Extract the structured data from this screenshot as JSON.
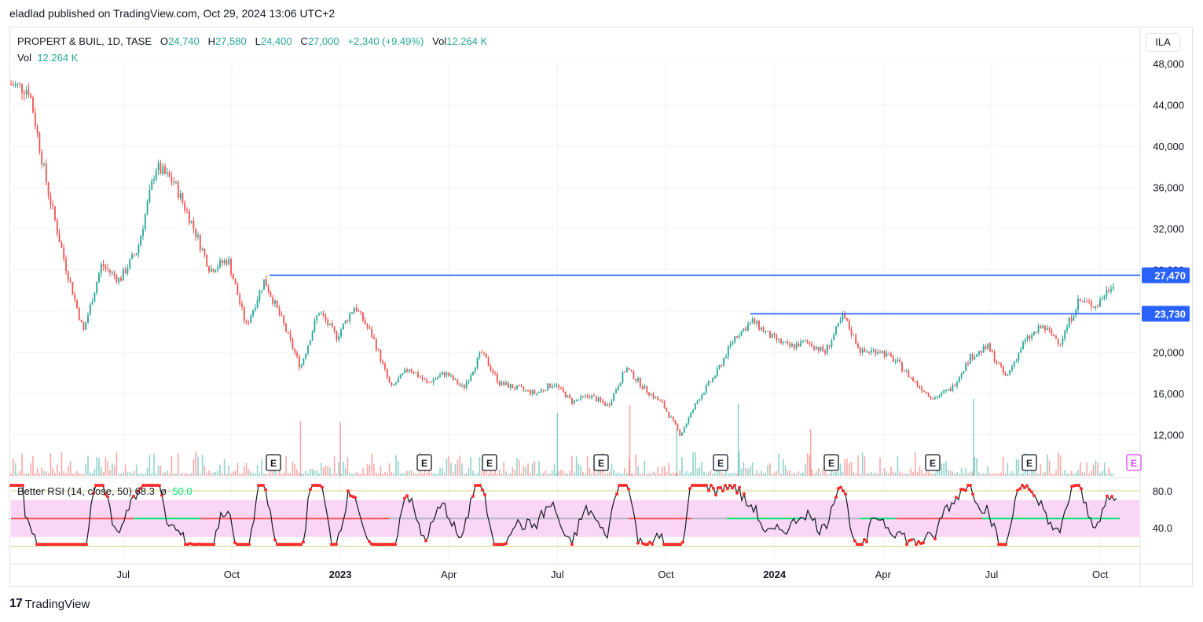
{
  "header": {
    "published_line": "eladlad published on TradingView.com, Oct 29, 2024 13:06 UTC+2"
  },
  "legend": {
    "symbol": "PROPERT & BUIL, 1D, TASE",
    "open_label": "O",
    "open": "24,740",
    "high_label": "H",
    "high": "27,580",
    "low_label": "L",
    "low": "24,400",
    "close_label": "C",
    "close": "27,000",
    "change": "+2,340 (+9.49%)",
    "vol_label": "Vol",
    "vol": "12.264 K",
    "vol_line_label": "Vol",
    "vol_line_value": "12.264 K"
  },
  "rsi_legend": {
    "title": "Better RSI (14, close, 50)",
    "value": "68.3",
    "symbol": "ø",
    "mid": "50.0"
  },
  "currency_button": "ILA",
  "footer": {
    "brand": "TradingView",
    "logo_glyph": "17"
  },
  "colors": {
    "up": "#26a69a",
    "down": "#ef5350",
    "hline": "#2962ff",
    "rsi_band": "#f9d6f5",
    "rsi_above": "#ff2a2a",
    "rsi_mid_green": "#00e676",
    "rsi_mid_red": "#ff5252",
    "rsi_mid_gray": "#b2b5be",
    "earnings_alt": "#e040fb"
  },
  "chart_data": {
    "type": "candlestick",
    "title": "PROPERT & BUIL, 1D, TASE",
    "x_ticks": [
      "Jul",
      "Oct",
      "2023",
      "Apr",
      "Jul",
      "Oct",
      "2024",
      "Apr",
      "Jul",
      "Oct"
    ],
    "y_ticks": [
      "48,000",
      "44,000",
      "40,000",
      "36,000",
      "32,000",
      "28,000",
      "24,000",
      "20,000",
      "16,000",
      "12,000"
    ],
    "y_range": [
      8500,
      50500
    ],
    "close_path": [
      {
        "t": "Apr 2022",
        "c": 46000
      },
      {
        "t": "May 2022",
        "c": 45500
      },
      {
        "t": "Jun 2022",
        "c": 36000
      },
      {
        "t": "Jun 2022",
        "c": 28500
      },
      {
        "t": "Jul 2022",
        "c": 22000
      },
      {
        "t": "Jul 2022",
        "c": 28500
      },
      {
        "t": "Jul 2022",
        "c": 27000
      },
      {
        "t": "Aug 2022",
        "c": 30000
      },
      {
        "t": "Aug 2022",
        "c": 38000
      },
      {
        "t": "Sep 2022",
        "c": 36500
      },
      {
        "t": "Sep 2022",
        "c": 32500
      },
      {
        "t": "Oct 2022",
        "c": 28000
      },
      {
        "t": "Oct 2022",
        "c": 29000
      },
      {
        "t": "Nov 2022",
        "c": 22500
      },
      {
        "t": "Nov 2022",
        "c": 27000
      },
      {
        "t": "Dec 2022",
        "c": 23000
      },
      {
        "t": "Dec 2022",
        "c": 18500
      },
      {
        "t": "Jan 2023",
        "c": 24000
      },
      {
        "t": "Jan 2023",
        "c": 21500
      },
      {
        "t": "Feb 2023",
        "c": 24500
      },
      {
        "t": "Feb 2023",
        "c": 21500
      },
      {
        "t": "Mar 2023",
        "c": 16500
      },
      {
        "t": "Mar 2023",
        "c": 18500
      },
      {
        "t": "Apr 2023",
        "c": 17000
      },
      {
        "t": "Apr 2023",
        "c": 18000
      },
      {
        "t": "May 2023",
        "c": 16500
      },
      {
        "t": "May 2023",
        "c": 20000
      },
      {
        "t": "Jun 2023",
        "c": 17000
      },
      {
        "t": "Jun 2023",
        "c": 16500
      },
      {
        "t": "Jul 2023",
        "c": 16000
      },
      {
        "t": "Jul 2023",
        "c": 17000
      },
      {
        "t": "Aug 2023",
        "c": 15200
      },
      {
        "t": "Aug 2023",
        "c": 15800
      },
      {
        "t": "Sep 2023",
        "c": 14800
      },
      {
        "t": "Sep 2023",
        "c": 18500
      },
      {
        "t": "Oct 2023",
        "c": 16500
      },
      {
        "t": "Oct 2023",
        "c": 15000
      },
      {
        "t": "Nov 2023",
        "c": 12000
      },
      {
        "t": "Nov 2023",
        "c": 15500
      },
      {
        "t": "Dec 2023",
        "c": 18000
      },
      {
        "t": "Dec 2023",
        "c": 21500
      },
      {
        "t": "Jan 2024",
        "c": 23000
      },
      {
        "t": "Jan 2024",
        "c": 21500
      },
      {
        "t": "Feb 2024",
        "c": 20500
      },
      {
        "t": "Feb 2024",
        "c": 21000
      },
      {
        "t": "Mar 2024",
        "c": 20000
      },
      {
        "t": "Mar 2024",
        "c": 23500
      },
      {
        "t": "Apr 2024",
        "c": 20000
      },
      {
        "t": "Apr 2024",
        "c": 20200
      },
      {
        "t": "May 2024",
        "c": 19000
      },
      {
        "t": "May 2024",
        "c": 17000
      },
      {
        "t": "Jun 2024",
        "c": 15500
      },
      {
        "t": "Jun 2024",
        "c": 16500
      },
      {
        "t": "Jul 2024",
        "c": 19500
      },
      {
        "t": "Jul 2024",
        "c": 20500
      },
      {
        "t": "Aug 2024",
        "c": 17500
      },
      {
        "t": "Aug 2024",
        "c": 21000
      },
      {
        "t": "Sep 2024",
        "c": 22500
      },
      {
        "t": "Sep 2024",
        "c": 21000
      },
      {
        "t": "Sep 2024",
        "c": 25000
      },
      {
        "t": "Oct 2024",
        "c": 24500
      },
      {
        "t": "Oct 2024",
        "c": 27000
      }
    ],
    "horizontal_lines": [
      {
        "label": "27,470",
        "value": 27470,
        "start": "Nov 2022"
      },
      {
        "label": "23,730",
        "value": 23730,
        "start": "Dec 2023"
      }
    ],
    "earnings_markers": [
      {
        "t": "Nov 2022",
        "label": "E"
      },
      {
        "t": "Mar 2023",
        "label": "E"
      },
      {
        "t": "Apr 2023",
        "label": "E"
      },
      {
        "t": "Aug 2023",
        "label": "E"
      },
      {
        "t": "Nov 2023",
        "label": "E"
      },
      {
        "t": "Mar 2024",
        "label": "E"
      },
      {
        "t": "Jun 2024",
        "label": "E"
      },
      {
        "t": "Aug 2024",
        "label": "E"
      },
      {
        "t": "Nov 2024",
        "label": "E"
      }
    ],
    "volume_label": "Vol",
    "rsi": {
      "name": "Better RSI (14, close, 50)",
      "value": 68.3,
      "midline": 50,
      "y_ticks": [
        "80.0",
        "40.0"
      ],
      "y_range": [
        15,
        90
      ],
      "band": [
        30,
        70
      ]
    }
  }
}
